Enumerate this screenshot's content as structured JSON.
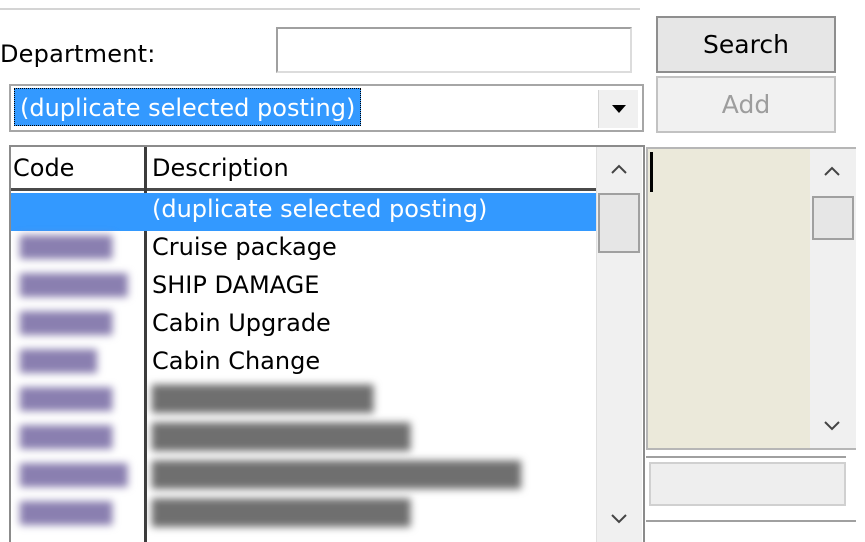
{
  "department": {
    "label": "Department:",
    "value": ""
  },
  "buttons": {
    "search": "Search",
    "add": "Add"
  },
  "combo": {
    "selected": "(duplicate selected posting)"
  },
  "list": {
    "columns": [
      "Code",
      "Description"
    ],
    "rows": [
      {
        "code": "",
        "description": "(duplicate selected posting)",
        "selected": true
      },
      {
        "code": "",
        "description": "Cruise package"
      },
      {
        "code": "",
        "description": "SHIP DAMAGE"
      },
      {
        "code": "",
        "description": "Cabin Upgrade"
      },
      {
        "code": "",
        "description": "Cabin Change"
      }
    ]
  },
  "icons": {
    "dropdown": "chevron-down-icon",
    "scroll_up": "chevron-up-icon",
    "scroll_down": "chevron-down-icon"
  },
  "colors": {
    "selection": "#3399ff",
    "panel": "#ebe9da"
  }
}
